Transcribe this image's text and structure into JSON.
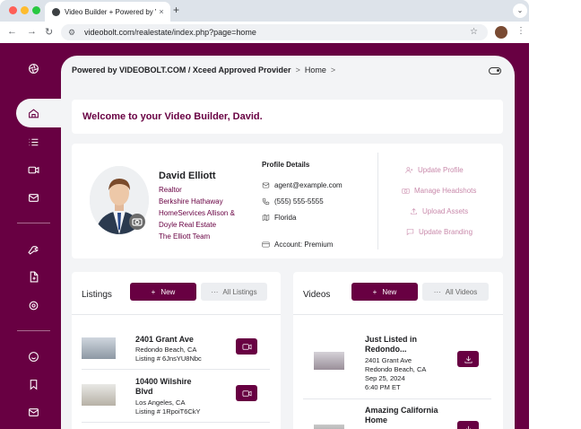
{
  "browser": {
    "tab_title": "Video Builder + Powered by V",
    "tab_close": "×",
    "new_tab": "+",
    "tab_menu": "⌄",
    "url": "videobolt.com/realestate/index.php?page=home"
  },
  "breadcrumb": {
    "brand": "Powered by VIDEOBOLT.COM / Xceed Approved Provider",
    "sep1": ">",
    "home": "Home",
    "sep2": ">"
  },
  "welcome": "Welcome to your Video Builder, David.",
  "profile": {
    "name": "David Elliott",
    "role": "Realtor",
    "company_lines": [
      "Berkshire Hathaway",
      "HomeServices Allison &",
      "Doyle Real Estate"
    ],
    "team": "The Elliott Team",
    "details_title": "Profile Details",
    "email": "agent@example.com",
    "phone": "(555) 555-5555",
    "state": "Florida",
    "account": "Account: Premium"
  },
  "actions": [
    "Update Profile",
    "Manage Headshots",
    "Upload Assets",
    "Update Branding"
  ],
  "listings": {
    "title": "Listings",
    "new_label": "New",
    "new_icon": "+",
    "all_label": "All Listings",
    "all_icon": "···",
    "items": [
      {
        "title": "2401 Grant Ave",
        "city": "Redondo Beach, CA",
        "listing": "Listing # 6JnsYU8Nbc"
      },
      {
        "title_l1": "10400 Wilshire",
        "title_l2": "Blvd",
        "city": "Los Angeles, CA",
        "listing": "Listing # 1RpoiT6CkY"
      }
    ]
  },
  "videos": {
    "title": "Videos",
    "new_label": "New",
    "new_icon": "+",
    "all_label": "All Videos",
    "all_icon": "···",
    "items": [
      {
        "title_l1": "Just Listed in",
        "title_l2": "Redondo...",
        "address": "2401 Grant Ave",
        "city": "Redondo Beach, CA",
        "date": "Sep 25, 2024",
        "time": "6:40 PM ET"
      },
      {
        "title_l1": "Amazing California",
        "title_l2": "Home"
      }
    ]
  },
  "colors": {
    "brand": "#680042",
    "accent_light": "#c98aab"
  }
}
